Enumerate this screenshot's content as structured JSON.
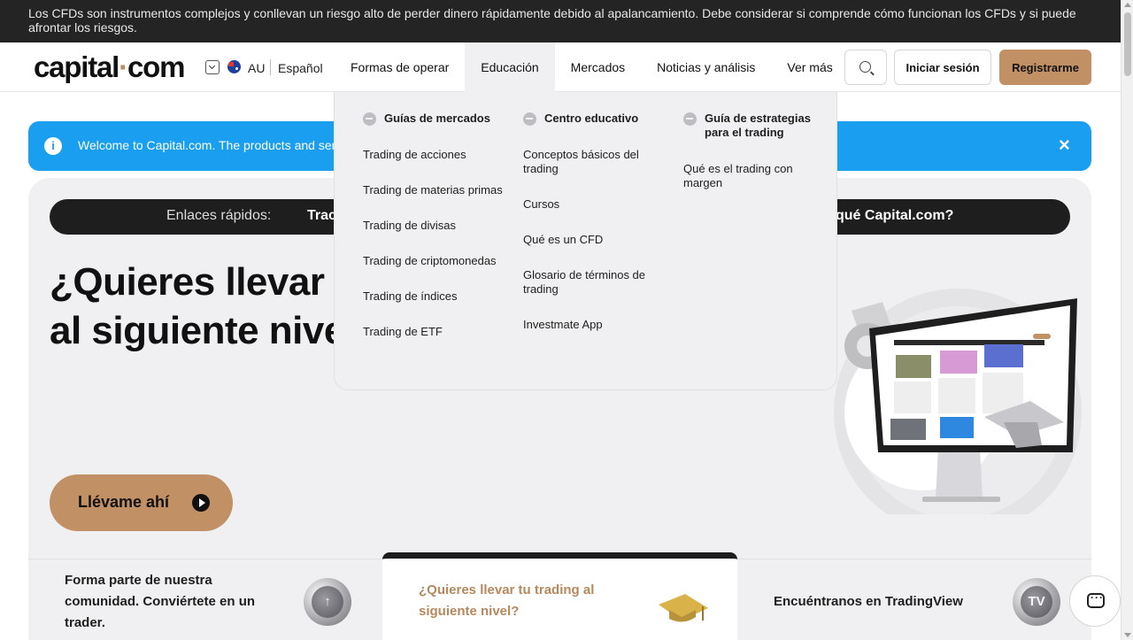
{
  "risk_banner": {
    "text": "Los CFDs son instrumentos complejos y conllevan un riesgo alto de perder dinero rápidamente debido al apalancamiento. Debe considerar si comprende cómo funcionan los CFDs y si puede afrontar los riesgos."
  },
  "header": {
    "logo": {
      "left": "capital",
      "dot": "·",
      "right": "com"
    },
    "country": "AU",
    "language": "Español",
    "nav": [
      "Formas de operar",
      "Educación",
      "Mercados",
      "Noticias y análisis",
      "Ver más"
    ],
    "active_nav": "Educación",
    "login": "Iniciar sesión",
    "register": "Registrarme"
  },
  "notice": {
    "text": "Welcome to Capital.com. The products and servi",
    "close": "×"
  },
  "hero": {
    "quicklinks_label": "Enlaces rápidos:",
    "quicklinks_first": "Trac",
    "quicklinks_last": "qué Capital.com?",
    "headline": "¿Quieres llevar tu trading al siguiente nivel?",
    "cta": "Llévame ahí"
  },
  "cards": [
    {
      "text": "Forma parte de nuestra comunidad. Conviértete en un trader."
    },
    {
      "text": "¿Quieres llevar tu trading al siguiente nivel?"
    },
    {
      "text": "Encuéntranos en TradingView"
    }
  ],
  "dropdown": {
    "columns": [
      {
        "heading": "Guías de mercados",
        "items": [
          "Trading de acciones",
          "Trading de materias primas",
          "Trading de divisas",
          "Trading de criptomonedas",
          "Trading de índices",
          "Trading de ETF"
        ]
      },
      {
        "heading": "Centro educativo",
        "items": [
          "Conceptos básicos del trading",
          "Cursos",
          "Qué es un CFD",
          "Glosario de términos de trading",
          "Investmate App"
        ]
      },
      {
        "heading": "Guía de estrategias para el trading",
        "items": [
          "Qué es el trading con margen"
        ]
      }
    ]
  },
  "colors": {
    "accent": "#c19065",
    "notice_blue": "#1a9ef0",
    "dark": "#1e1e1e"
  }
}
